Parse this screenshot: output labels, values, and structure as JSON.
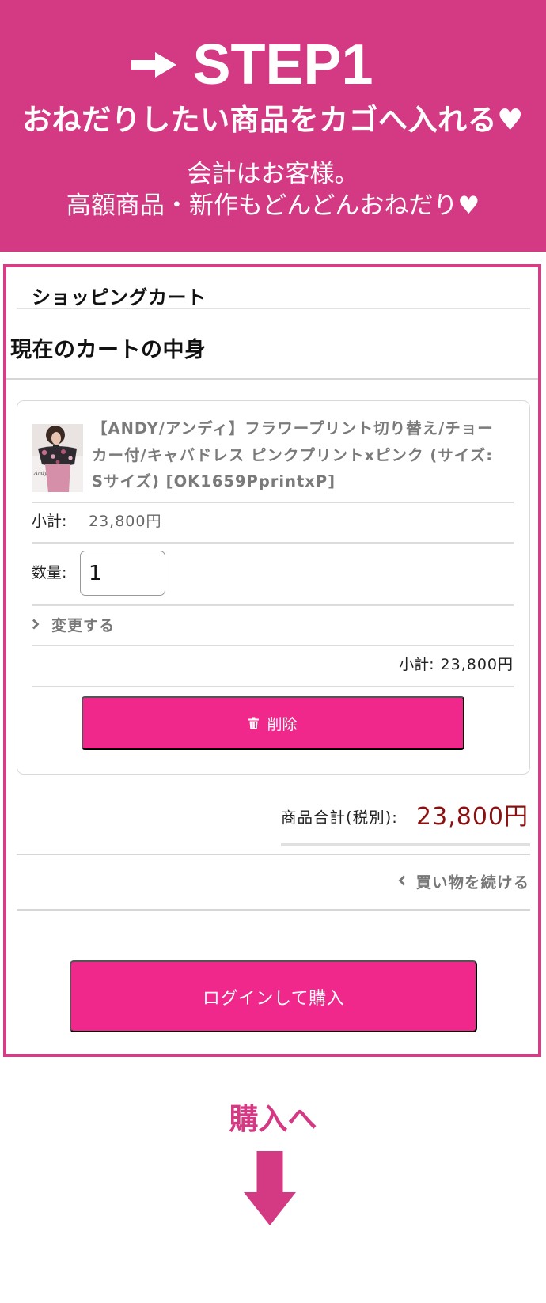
{
  "banner": {
    "step_label": "STEP1",
    "headline": "おねだりしたい商品をカゴへ入れる♥",
    "note_line1": "会計はお客様。",
    "note_line2": "高額商品・新作もどんどんおねだり♥"
  },
  "cart": {
    "title": "ショッピングカート",
    "section_heading": "現在のカートの中身",
    "item": {
      "thumbnail_logo": "Andy",
      "name": "【ANDY/アンディ】フラワープリント切り替え/チョーカー付/キャバドレス ピンクプリントxピンク (サイズ: Sサイズ) [OK1659PprintxP]",
      "unit_subtotal_label": "小計:",
      "unit_subtotal_value": "23,800円",
      "quantity_label": "数量:",
      "quantity_value": "1",
      "change_label": "変更する",
      "line_subtotal_label": "小計:",
      "line_subtotal_value": "23,800円",
      "delete_label": "削除"
    },
    "total_label": "商品合計(税別):",
    "total_value": "23,800円",
    "continue_shopping_label": "買い物を続ける",
    "login_purchase_label": "ログインして購入"
  },
  "next_step": {
    "label": "購入へ"
  },
  "icons": {
    "banner_arrow": "right-arrow-icon",
    "change": "chevron-right-icon",
    "delete": "trash-icon",
    "continue": "chevron-left-icon",
    "next": "down-arrow-icon"
  },
  "colors": {
    "banner_pink": "#d43a83",
    "frame_pink": "#d23f84",
    "button_pink": "#f0288c",
    "price_red": "#8b1111"
  }
}
